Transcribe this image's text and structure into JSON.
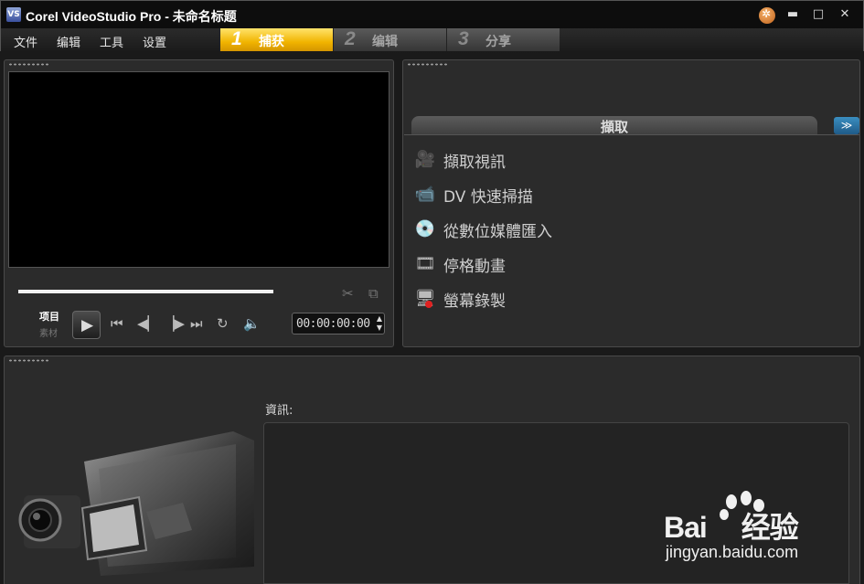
{
  "window": {
    "title": "Corel VideoStudio Pro - 未命名标题",
    "app_icon_text": "VS",
    "minimize": "▬",
    "maximize": "□",
    "close": "✕"
  },
  "menu": {
    "items": [
      "文件",
      "编辑",
      "工具",
      "设置"
    ]
  },
  "steps": [
    {
      "num": "1",
      "label": "捕获",
      "active": true
    },
    {
      "num": "2",
      "label": "编辑",
      "active": false
    },
    {
      "num": "3",
      "label": "分享",
      "active": false
    }
  ],
  "player": {
    "mode_project": "项目",
    "mode_clip": "素材",
    "timecode": "00:00:00:00",
    "spin_up": "▲",
    "spin_down": "▼",
    "progress": 0.0
  },
  "icons": {
    "scissors": "✂",
    "copy": "⧉",
    "play": "▶",
    "home": "⏮",
    "prev": "◀▏",
    "next": "▕▶",
    "end": "⏭",
    "repeat": "↻",
    "volume": "🔈",
    "collapse": "≫",
    "capture_video": "🎥",
    "dv_scan": "📹",
    "import_digital": "💿",
    "stop_motion": "🎞",
    "screen_capture": "🖥"
  },
  "capture": {
    "header": "擷取",
    "options": [
      "擷取視訊",
      "DV 快速掃描",
      "從數位媒體匯入",
      "停格動畫",
      "螢幕錄製"
    ]
  },
  "info": {
    "label": "資訊:"
  },
  "watermark": {
    "brand": "Bai\u0000du经验",
    "url": "jingyan.baidu.com"
  }
}
